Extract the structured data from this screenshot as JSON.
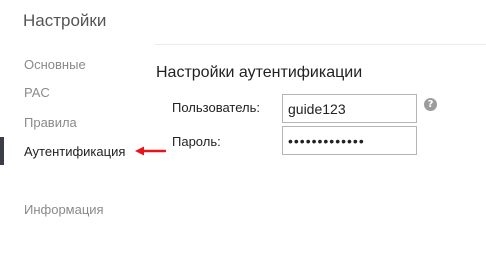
{
  "page": {
    "title": "Настройки"
  },
  "sidebar": {
    "items": [
      {
        "label": "Основные"
      },
      {
        "label": "PAC"
      },
      {
        "label": "Правила"
      },
      {
        "label": "Аутентификация",
        "active": true
      },
      {
        "label": "Информация"
      }
    ]
  },
  "main": {
    "section_title": "Настройки аутентификации",
    "fields": {
      "username": {
        "label": "Пользователь:",
        "value": "guide123"
      },
      "password": {
        "label": "Пароль:",
        "value": "•••••••••••••"
      }
    },
    "help_icon": {
      "icon": "help-icon",
      "glyph": "?"
    }
  },
  "annotation": {
    "icon": "red-arrow-left-icon",
    "color": "#e8141b"
  },
  "colors": {
    "active_marker": "#3a3f47",
    "arrow": "#e8141b"
  }
}
